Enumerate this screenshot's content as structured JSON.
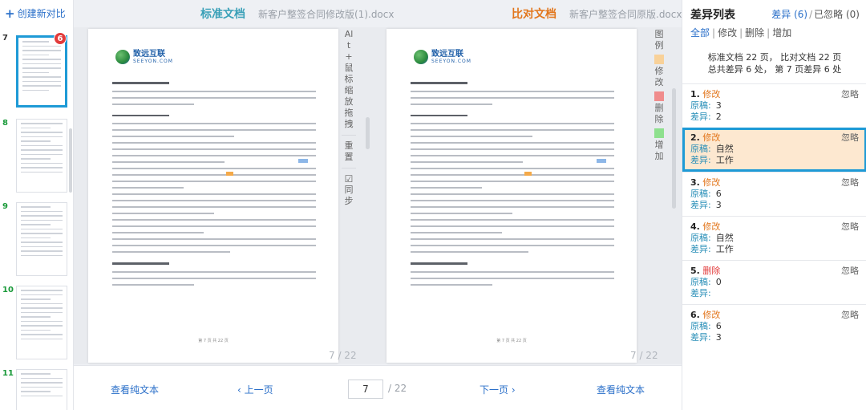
{
  "left": {
    "create_label": "创建新对比",
    "thumbs": [
      {
        "num": "7",
        "active": true,
        "badge": "6"
      },
      {
        "num": "8",
        "active": false
      },
      {
        "num": "9",
        "active": false
      },
      {
        "num": "10",
        "active": false
      },
      {
        "num": "11",
        "active": false
      }
    ]
  },
  "standard": {
    "title": "标准文档",
    "filename": "新客户整签合同修改版(1).docx",
    "page_counter": "7 / 22",
    "tools": {
      "zoom_hint": "Alt + 鼠标缩放拖拽",
      "reset": "重置",
      "sync": "同步"
    }
  },
  "compare": {
    "title": "比对文档",
    "filename": "新客户整签合同原版.docx",
    "page_counter": "7 / 22",
    "legend": {
      "title": "图例",
      "modify": "修改",
      "delete": "删除",
      "add": "增加"
    }
  },
  "document": {
    "logo_cn": "致远互联",
    "logo_en": "SEEYON.COM",
    "footer": "第 7 页 共 22 页"
  },
  "bottom": {
    "plain_text_left": "查看纯文本",
    "prev": "上一页",
    "page_value": "7",
    "page_total": "/ 22",
    "next": "下一页",
    "plain_text_right": "查看纯文本"
  },
  "diff_panel": {
    "title": "差异列表",
    "diff_tab": "差异 (6)",
    "ignored_tab": "已忽略 (0)",
    "filters": [
      "全部",
      "修改",
      "删除",
      "增加"
    ],
    "summary_line1": "标准文档 22 页， 比对文档 22 页",
    "summary_line2": "总共差异 6 处， 第 7 页差异 6 处",
    "ignore_label": "忽略",
    "orig_label": "原稿:",
    "diff_label": "差异:",
    "items": [
      {
        "idx": "1.",
        "kind": "修改",
        "type": "mod",
        "orig": "3",
        "diff": "2",
        "active": false
      },
      {
        "idx": "2.",
        "kind": "修改",
        "type": "mod",
        "orig": "自然",
        "diff": "工作",
        "active": true
      },
      {
        "idx": "3.",
        "kind": "修改",
        "type": "mod",
        "orig": "6",
        "diff": "3",
        "active": false
      },
      {
        "idx": "4.",
        "kind": "修改",
        "type": "mod",
        "orig": "自然",
        "diff": "工作",
        "active": false
      },
      {
        "idx": "5.",
        "kind": "删除",
        "type": "del",
        "orig": "0",
        "diff": "",
        "active": false
      },
      {
        "idx": "6.",
        "kind": "修改",
        "type": "mod",
        "orig": "6",
        "diff": "3",
        "active": false
      }
    ]
  },
  "colors": {
    "accent_blue": "#2a6fc9",
    "standard_title": "#3aa0b8",
    "compare_title": "#e2761c",
    "legend_modify": "#f8d199",
    "legend_delete": "#f08c8c",
    "legend_add": "#8ee08e",
    "active_border": "#1e9ad6"
  }
}
